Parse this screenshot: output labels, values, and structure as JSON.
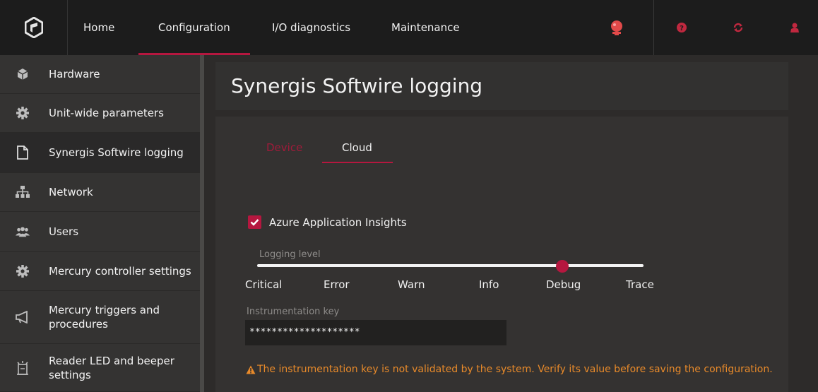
{
  "topbar": {
    "nav": [
      {
        "label": "Home"
      },
      {
        "label": "Configuration",
        "active": true
      },
      {
        "label": "I/O diagnostics"
      },
      {
        "label": "Maintenance"
      }
    ],
    "icons": [
      "logo-icon",
      "alarm-icon",
      "help-icon",
      "refresh-icon",
      "user-icon"
    ]
  },
  "sidebar": {
    "items": [
      {
        "label": "Hardware",
        "icon": "cube-icon"
      },
      {
        "label": "Unit-wide parameters",
        "icon": "gear-icon"
      },
      {
        "label": "Synergis Softwire logging",
        "icon": "document-icon",
        "active": true
      },
      {
        "label": "Network",
        "icon": "network-icon"
      },
      {
        "label": "Users",
        "icon": "users-icon"
      },
      {
        "label": "Mercury controller settings",
        "icon": "gear-icon"
      },
      {
        "label": "Mercury triggers and procedures",
        "icon": "megaphone-icon"
      },
      {
        "label": "Reader LED and beeper settings",
        "icon": "reader-icon"
      }
    ]
  },
  "main": {
    "title": "Synergis Softwire logging",
    "tabs": [
      {
        "label": "Device"
      },
      {
        "label": "Cloud",
        "active": true
      }
    ],
    "azure": {
      "label": "Azure Application Insights",
      "checked": true
    },
    "logging": {
      "label": "Logging level",
      "levels": [
        "Critical",
        "Error",
        "Warn",
        "Info",
        "Debug",
        "Trace"
      ],
      "selected": "Debug"
    },
    "instrumentation": {
      "label": "Instrumentation key",
      "value": "********************"
    },
    "warning": "The instrumentation key is not validated by the system. Verify its value before saving the configuration."
  },
  "colors": {
    "accent": "#b5173f",
    "warning": "#e88a2a"
  }
}
